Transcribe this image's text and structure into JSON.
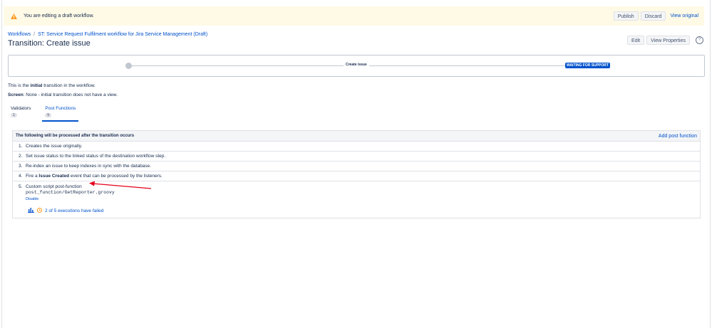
{
  "banner": {
    "text": "You are editing a draft workflow.",
    "publish_label": "Publish",
    "discard_label": "Discard",
    "view_original_label": "View original"
  },
  "breadcrumb": {
    "root": "Workflows",
    "separator": "/",
    "current": "ST: Service Request Fulfilment workflow for Jira Service Management (Draft)"
  },
  "page": {
    "title": "Transition: Create issue",
    "edit_label": "Edit",
    "view_properties_label": "View Properties",
    "help_glyph": "?"
  },
  "diagram": {
    "transition_label": "Create issue",
    "target_status": "WAITING FOR SUPPORT",
    "status_color": "#0052cc"
  },
  "info": {
    "line1_prefix": "This is the ",
    "line1_bold": "initial",
    "line1_suffix": " transition in the workflow.",
    "line2_bold": "Screen",
    "line2_rest": ": None - initial transition does not have a view."
  },
  "tabs": [
    {
      "label": "Validators",
      "count": "1"
    },
    {
      "label": "Post Functions",
      "count": "5"
    }
  ],
  "panel": {
    "title": "The following will be processed after the transition occurs",
    "add_label": "Add post function",
    "items": [
      {
        "num": "1.",
        "text": "Creates the issue originally."
      },
      {
        "num": "2.",
        "text": "Set issue status to the linked status of the destination workflow step."
      },
      {
        "num": "3.",
        "text": "Re-index an issue to keep indexes in sync with the database."
      }
    ],
    "item4": {
      "num": "4.",
      "prefix": "Fire a ",
      "bold": "Issue Created",
      "suffix": " event that can be processed by the listeners."
    },
    "item5": {
      "num": "5.",
      "title": "Custom script post-function",
      "path": "post_function/GetReporter.groovy",
      "disable_label": "Disable",
      "executions": "2 of 5 executions have failed"
    }
  },
  "colors": {
    "accent": "#0052cc",
    "warning_bg": "#fffae6",
    "warning_icon": "#ff991f",
    "annotation_arrow": "#e5001b"
  },
  "icons": [
    "warning-icon",
    "help-icon",
    "chart-icon",
    "clock-warning-icon"
  ]
}
